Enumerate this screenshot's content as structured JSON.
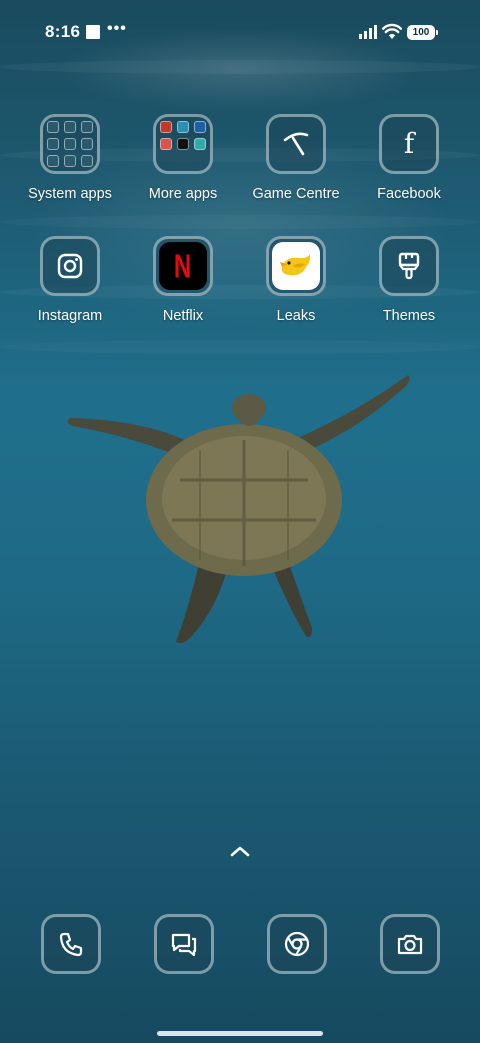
{
  "status_bar": {
    "time": "8:16",
    "more_indicator": "•••",
    "battery": "100"
  },
  "home_apps": [
    {
      "label": "System apps",
      "icon": "folder-icon"
    },
    {
      "label": "More apps",
      "icon": "folder-icon"
    },
    {
      "label": "Game Centre",
      "icon": "game-centre-icon"
    },
    {
      "label": "Facebook",
      "icon": "facebook-icon"
    },
    {
      "label": "Instagram",
      "icon": "instagram-icon"
    },
    {
      "label": "Netflix",
      "icon": "netflix-icon"
    },
    {
      "label": "Leaks",
      "icon": "leaks-bird-icon"
    },
    {
      "label": "Themes",
      "icon": "themes-brush-icon"
    }
  ],
  "netflix_letter": "N",
  "facebook_letter": "f",
  "dock": [
    {
      "icon": "phone-icon"
    },
    {
      "icon": "messages-icon"
    },
    {
      "icon": "chrome-icon"
    },
    {
      "icon": "camera-icon"
    }
  ],
  "colors": {
    "netflix_red": "#e50914",
    "leaks_yellow": "#f5c518",
    "tile_border": "#cde1e8"
  }
}
